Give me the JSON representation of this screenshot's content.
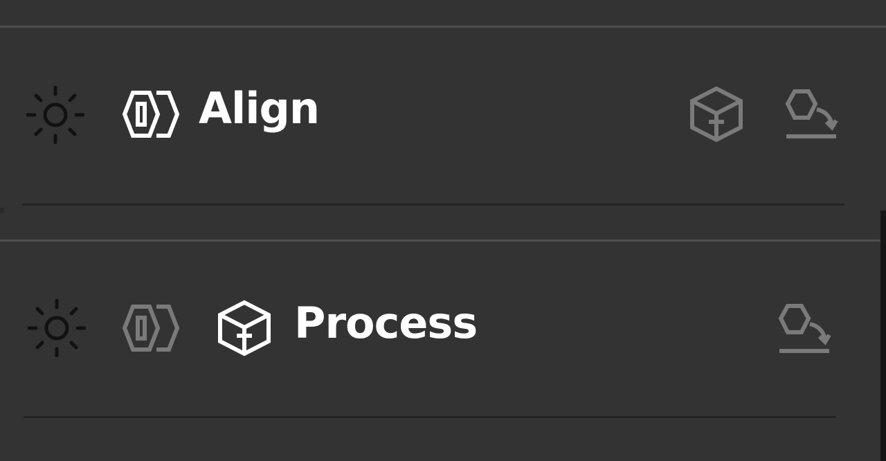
{
  "rows": [
    {
      "title": "Align",
      "icons": [
        "sun-icon",
        "align-hexagon-icon",
        "process-cube-icon",
        "export-shape-icon"
      ],
      "active": "align"
    },
    {
      "title": "Process",
      "icons": [
        "sun-icon",
        "align-hexagon-icon",
        "process-cube-icon",
        "export-shape-icon"
      ],
      "active": "process"
    }
  ],
  "colors": {
    "background": "#333333",
    "active_icon": "#ffffff",
    "inactive_icon": "#7a7a7a",
    "sun_icon": "#111111",
    "divider_light": "#4e4e4e",
    "divider_dark": "#232323"
  }
}
